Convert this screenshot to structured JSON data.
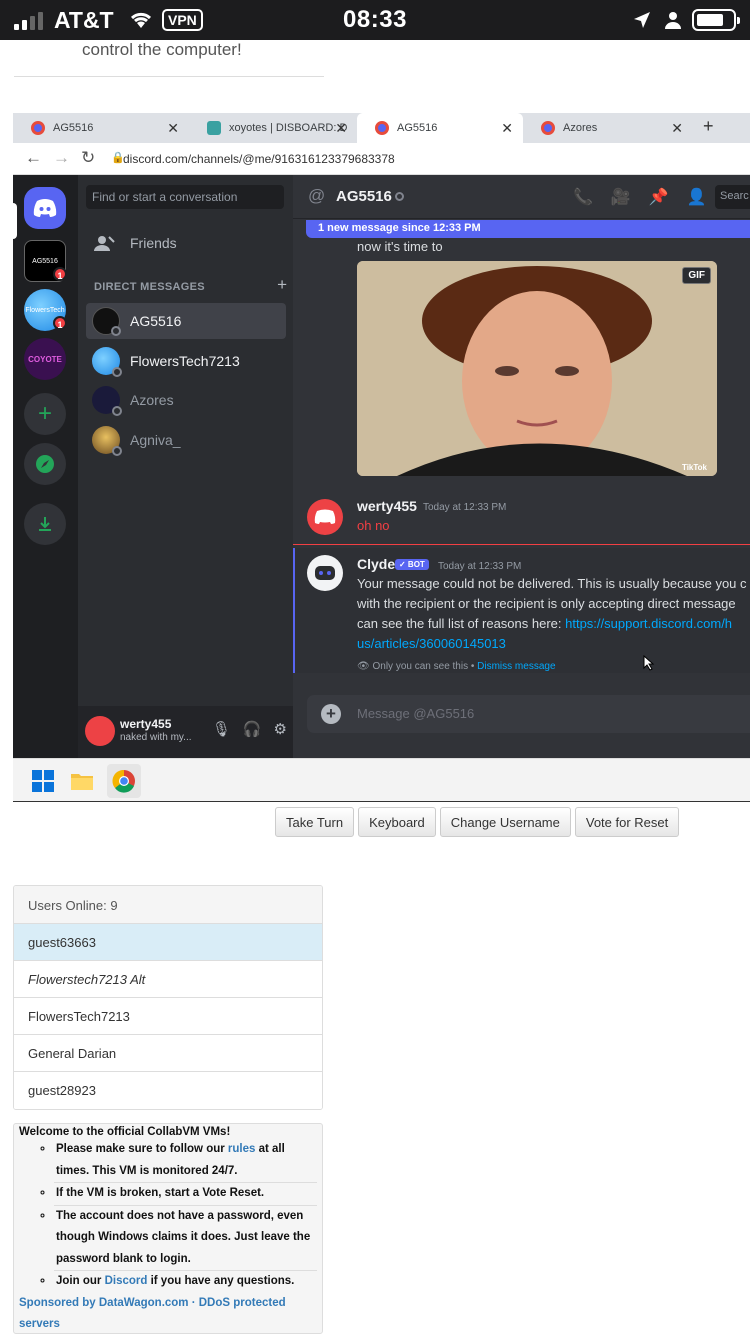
{
  "status_bar": {
    "carrier": "AT&T",
    "vpn": "VPN",
    "time": "08:33"
  },
  "top_note": "control the computer!",
  "browser": {
    "tabs": [
      {
        "title": "AG5516",
        "icon": "discord-favicon-icon"
      },
      {
        "title": "xoyotes | DISBOARD: D",
        "icon": "disboard-favicon-icon"
      },
      {
        "title": "AG5516",
        "icon": "discord-favicon-icon"
      },
      {
        "title": "Azores",
        "icon": "discord-favicon-icon"
      }
    ],
    "url": "discord.com/channels/@me/916316123379683378"
  },
  "discord": {
    "guild_labels": {
      "ag": "AG5516",
      "flowers": "FlowersTech",
      "coyote": "COYOTE"
    },
    "guild_badges": [
      "1",
      "1"
    ],
    "search_placeholder": "Find or start a conversation",
    "friends_label": "Friends",
    "dm_header": "DIRECT MESSAGES",
    "dms": [
      "AG5516",
      "FlowersTech7213",
      "Azores",
      "Agniva_"
    ],
    "user": {
      "name": "werty455",
      "status": "naked with my..."
    },
    "channel": {
      "name": "AG5516",
      "search": "Searc"
    },
    "new_messages_bar": "1 new message since 12:33 PM",
    "messages": {
      "gif_caption": "now it's time to",
      "gif_tag": "GIF",
      "gif_watermark": "TikTok",
      "m1": {
        "author": "werty455",
        "time": "Today at 12:33 PM",
        "text": "oh no"
      },
      "m2": {
        "author": "Clyde",
        "bot_tag": "✓ BOT",
        "time": "Today at 12:33 PM",
        "line1": "Your message could not be delivered. This is usually because you c",
        "line2": "with the recipient or the recipient is only accepting direct message",
        "line3": "can see the full list of reasons here: ",
        "link1": "https://support.discord.com/h",
        "link2": "us/articles/360060145013",
        "ephemeral": "Only you can see this •",
        "dismiss": "Dismiss message"
      }
    },
    "input_placeholder": "Message @AG5516"
  },
  "controls": {
    "take_turn": "Take Turn",
    "keyboard": "Keyboard",
    "change_username": "Change Username",
    "vote_reset": "Vote for Reset"
  },
  "users_online": {
    "header": "Users Online: 9",
    "users": [
      "guest63663",
      "Flowerstech7213 Alt",
      "FlowersTech7213",
      "General Darian",
      "guest28923"
    ]
  },
  "welcome": {
    "title": "Welcome to the official CollabVM VMs!",
    "rule1_pre": "Please make sure to follow our ",
    "rule1_link": "rules",
    "rule1_post": " at all times. This VM is monitored 24/7.",
    "rule2": "If the VM is broken, start a Vote Reset.",
    "rule3": "The account does not have a password, even though Windows claims it does. Just leave the password blank to login.",
    "rule4_pre": "Join our ",
    "rule4_link": "Discord",
    "rule4_post": " if you have any questions.",
    "sponsor": "Sponsored by DataWagon.com · DDoS protected servers"
  },
  "colors": {
    "discord_blurple": "#5865f2",
    "discord_red": "#f23f43",
    "link_blue": "#337ab7",
    "highlight_row": "#d9edf7"
  }
}
